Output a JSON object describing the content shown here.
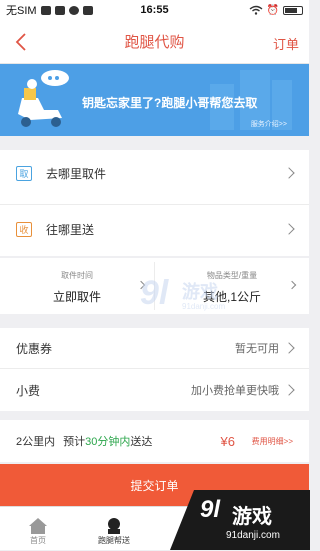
{
  "status_bar": {
    "carrier": "无SIM",
    "time": "16:55"
  },
  "nav": {
    "title": "跑腿代购",
    "order_link": "订单"
  },
  "banner": {
    "headline": "钥匙忘家里了?跑腿小哥帮您去取",
    "link": "服务介绍>>"
  },
  "addresses": [
    {
      "tag": "取",
      "tag_color": "#4aa3e0",
      "label": "去哪里取件"
    },
    {
      "tag": "收",
      "tag_color": "#e8903a",
      "label": "往哪里送"
    }
  ],
  "options": {
    "pickup_time": {
      "label": "取件时间",
      "value": "立即取件"
    },
    "item": {
      "label": "物品类型/重量",
      "value": "其他,1公斤"
    }
  },
  "coupon": {
    "label": "优惠券",
    "value": "暂无可用"
  },
  "tip": {
    "label": "小费",
    "value": "加小费抢单更快哦"
  },
  "estimate": {
    "distance": "2公里内",
    "prefix": "预计",
    "duration": "30分钟内",
    "suffix": "送达",
    "price": "¥6",
    "fee_link": "费用明细>>"
  },
  "submit_label": "提交订单",
  "tabs": [
    {
      "label": "首页"
    },
    {
      "label": "跑腿帮送"
    }
  ],
  "watermark": {
    "text1": "91danji.com",
    "text2": "91danji.com",
    "brand": "游戏"
  },
  "colors": {
    "accent": "#e05545",
    "banner": "#4d9fe6",
    "submit": "#f05a38",
    "duration_green": "#2aa54a"
  }
}
